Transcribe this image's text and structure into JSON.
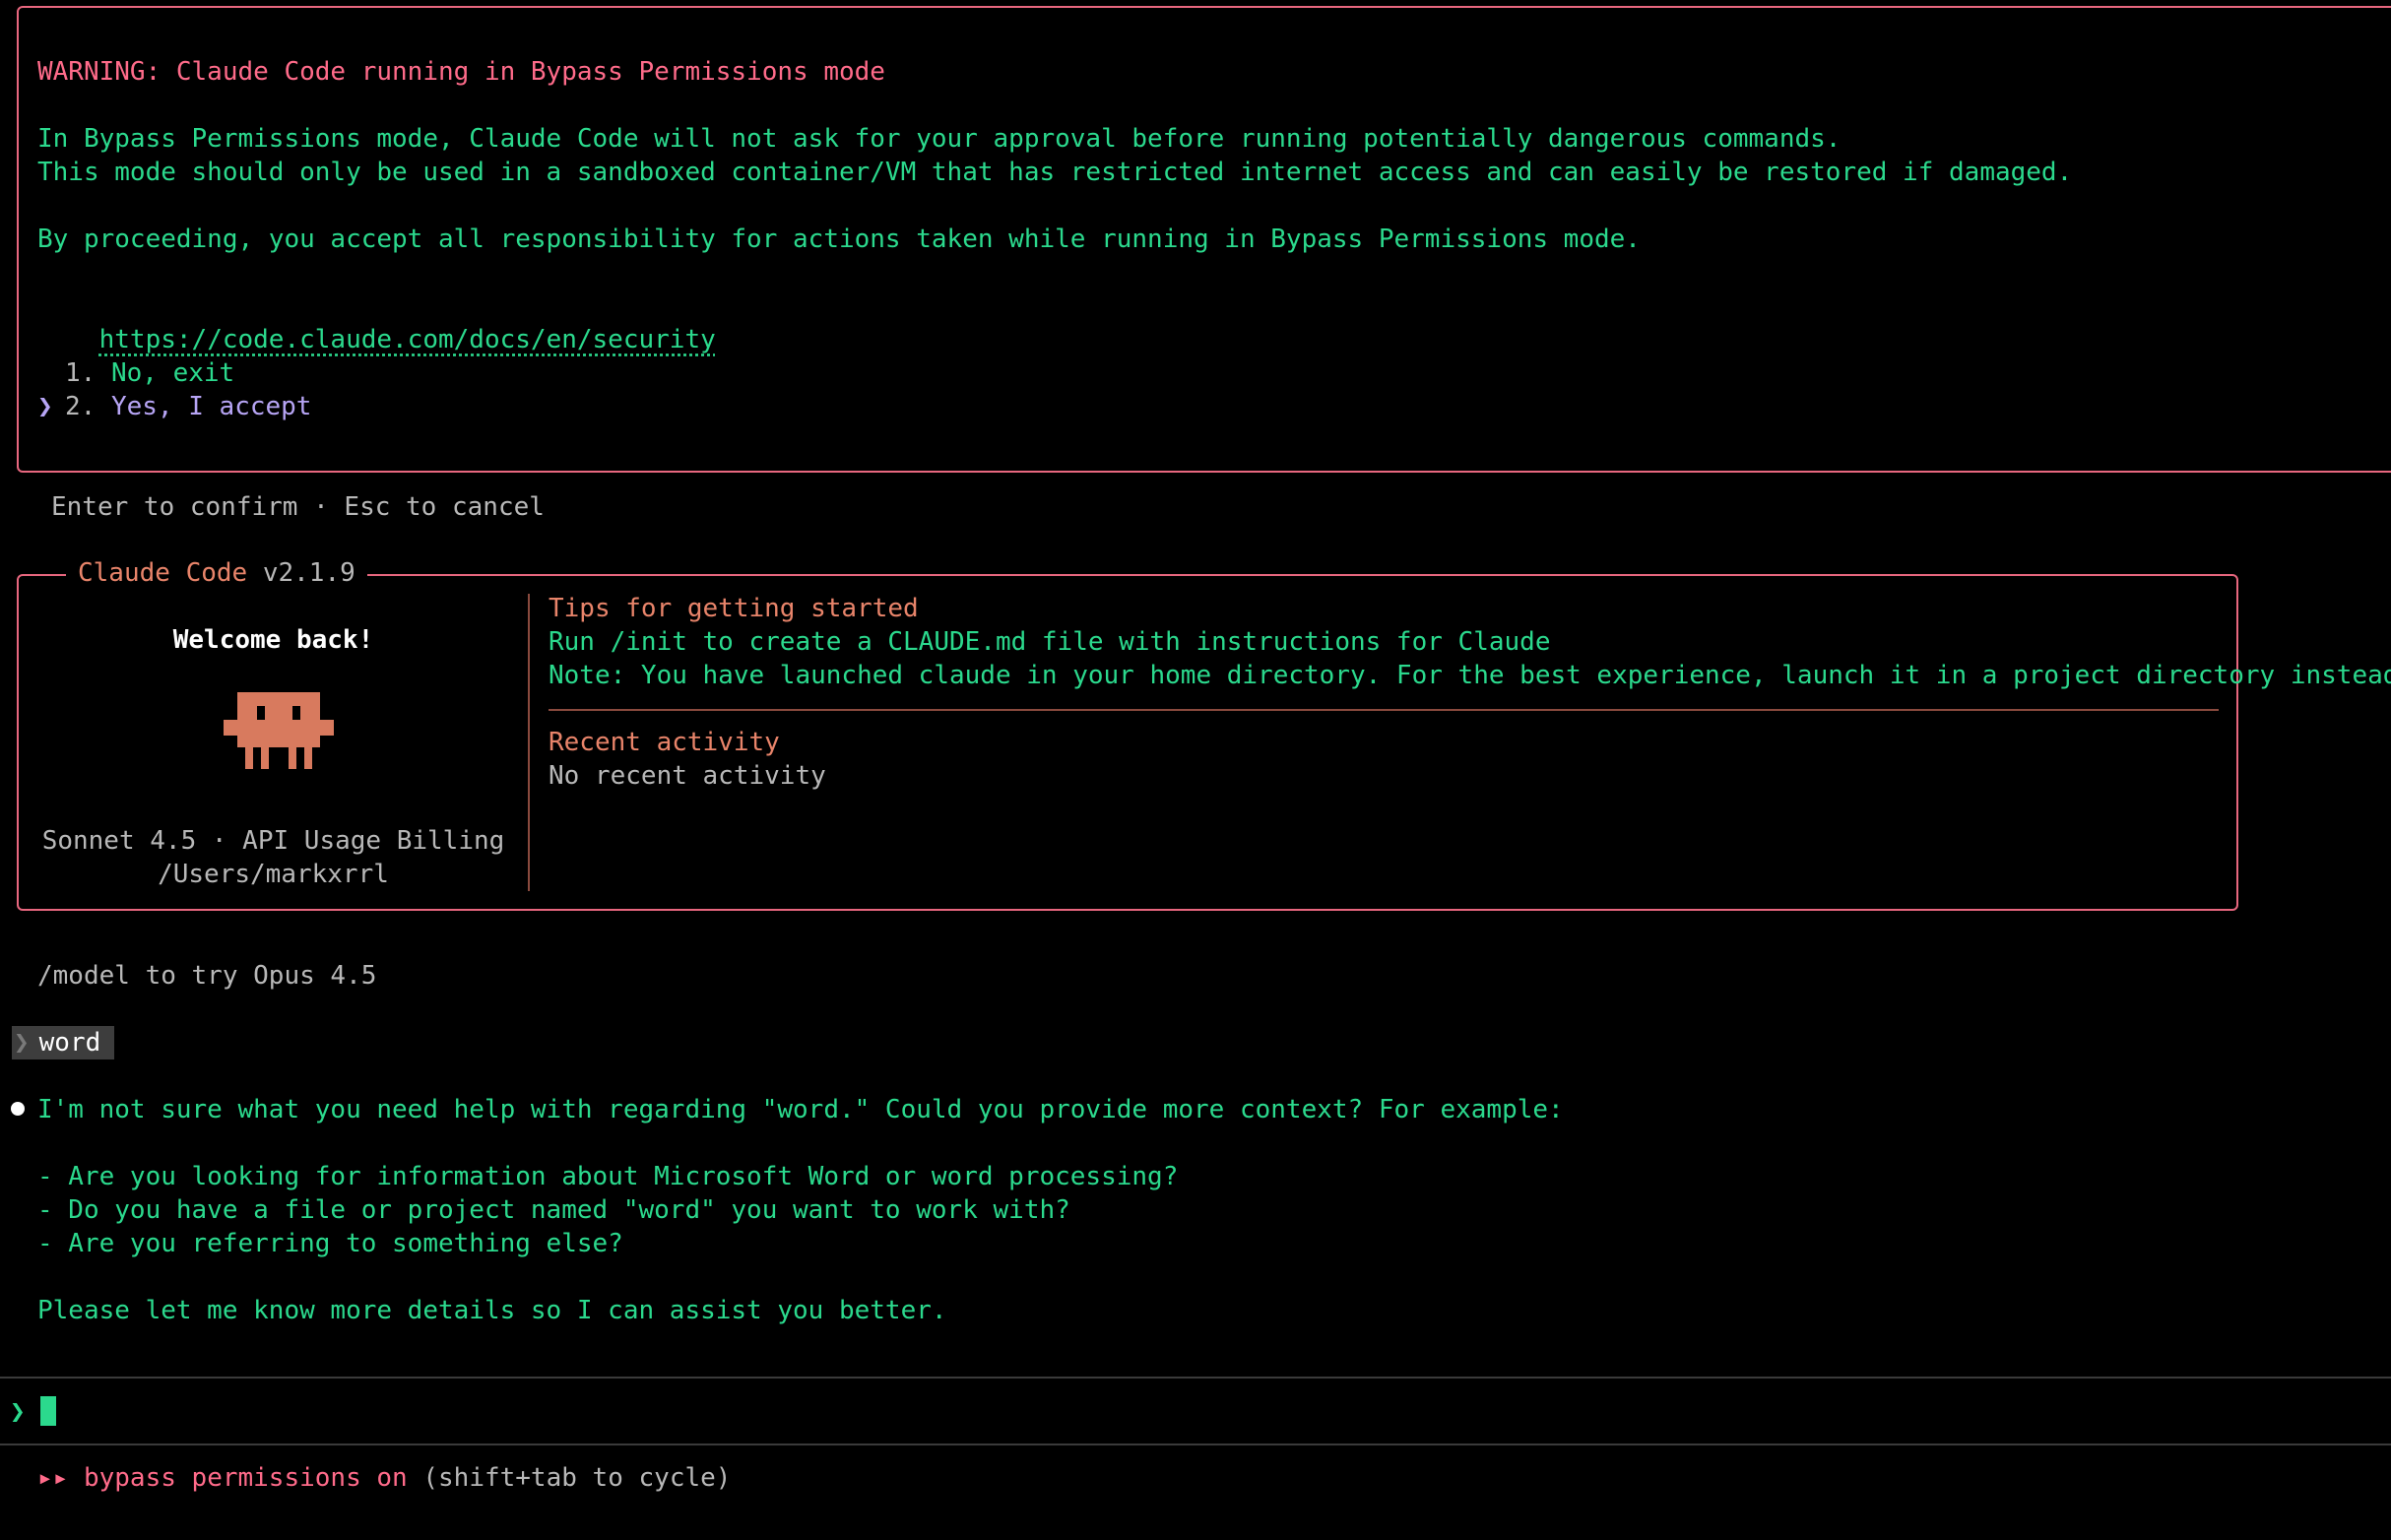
{
  "warning": {
    "title": "WARNING: Claude Code running in Bypass Permissions mode",
    "line1": "In Bypass Permissions mode, Claude Code will not ask for your approval before running potentially dangerous commands.",
    "line2": "This mode should only be used in a sandboxed container/VM that has restricted internet access and can easily be restored if damaged.",
    "line3": "By proceeding, you accept all responsibility for actions taken while running in Bypass Permissions mode.",
    "link": "https://code.claude.com/docs/en/security",
    "options": [
      {
        "number": "1.",
        "label": "No, exit"
      },
      {
        "number": "2.",
        "label": "Yes, I accept",
        "selected": true
      }
    ],
    "selector_glyph": "❯"
  },
  "hint": "Enter to confirm · Esc to cancel",
  "welcome": {
    "box_title": "Claude Code",
    "version": "v2.1.9",
    "greeting": "Welcome back!",
    "model_line": "Sonnet 4.5 · API Usage Billing",
    "path": "/Users/markxrrl",
    "tips_heading": "Tips for getting started",
    "tip1": "Run /init to create a CLAUDE.md file with instructions for Claude",
    "tip2": "Note: You have launched claude in your home directory. For the best experience, launch it in a project directory instead.",
    "recent_heading": "Recent activity",
    "recent_text": "No recent activity"
  },
  "model_hint": "/model to try Opus 4.5",
  "user_message": "word",
  "user_chevron": "❯",
  "assistant": {
    "line1": "I'm not sure what you need help with regarding \"word.\" Could you provide more context? For example:",
    "items": [
      "- Are you looking for information about Microsoft Word or word processing?",
      "- Do you have a file or project named \"word\" you want to work with?",
      "- Are you referring to something else?"
    ],
    "closing": "Please let me know more details so I can assist you better."
  },
  "prompt": {
    "chevron": "❯",
    "value": ""
  },
  "status": {
    "glyph": "▸▸",
    "mode": "bypass permissions on",
    "hint": "(shift+tab to cycle)"
  },
  "colors": {
    "accent_green": "#2bd98d",
    "warning_red": "#ff6b8a",
    "brand_orange": "#e8846a",
    "border": "#e8677f"
  }
}
